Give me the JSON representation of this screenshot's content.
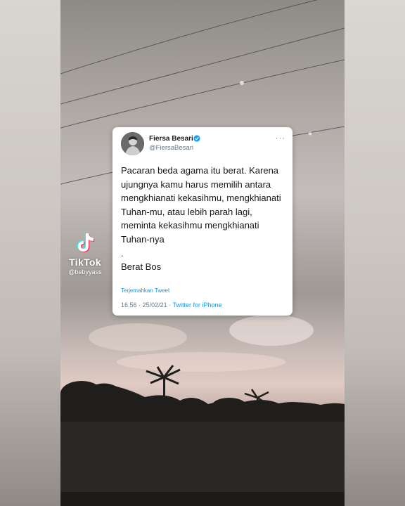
{
  "watermark": {
    "brand": "TikTok",
    "username": "@bebyyass"
  },
  "tweet": {
    "author_name": "Fiersa Besari",
    "handle": "@FiersaBesari",
    "more_label": "···",
    "text": "Pacaran beda agama itu berat. Karena ujungnya kamu harus memilih antara mengkhianati kekasihmu, mengkhianati Tuhan-mu, atau lebih parah lagi, meminta kekasihmu mengkhianati Tuhan-nya\n.\nBerat Bos",
    "translate_label": "Terjemahkan Tweet",
    "time": "16.56",
    "date": "25/02/21",
    "separator": "·",
    "source": "Twitter for iPhone"
  },
  "colors": {
    "link": "#1b95e0",
    "secondary_text": "#657786",
    "primary_text": "#14171a",
    "verified": "#1da1f2"
  },
  "icons": [
    "tiktok-logo-icon",
    "verified-badge-icon",
    "more-options-icon",
    "avatar-image"
  ]
}
